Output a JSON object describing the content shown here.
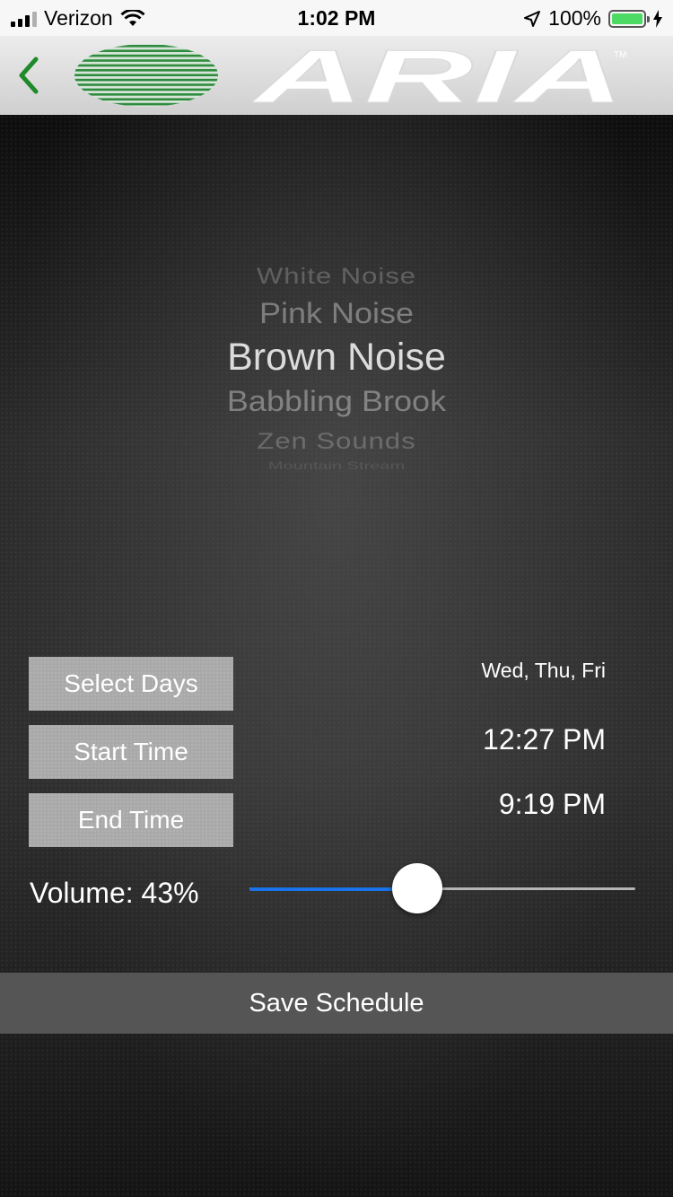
{
  "status_bar": {
    "carrier": "Verizon",
    "time": "1:02 PM",
    "battery_text": "100%",
    "icons": [
      "signal-icon",
      "wifi-icon",
      "location-icon",
      "battery-icon",
      "charging-icon"
    ]
  },
  "header": {
    "back_icon": "chevron-left-icon",
    "logo_text": "ARIA",
    "logo_tm": "TM",
    "colors": {
      "back": "#1e8a2a",
      "logo_stripes": "#2e8b3e"
    }
  },
  "sound_picker": {
    "items": [
      "White Noise",
      "Pink Noise",
      "Brown Noise",
      "Babbling Brook",
      "Zen Sounds",
      "Mountain Stream"
    ],
    "selected": "Brown Noise"
  },
  "schedule": {
    "select_days_label": "Select Days",
    "days_value": "Wed, Thu, Fri",
    "start_time_label": "Start Time",
    "start_time_value": "12:27 PM",
    "end_time_label": "End Time",
    "end_time_value": "9:19 PM"
  },
  "volume": {
    "label": "Volume: 43%",
    "level": 0.43,
    "colors": {
      "fill": "#1a73e8",
      "track": "#b5b5b5"
    }
  },
  "save_label": "Save Schedule"
}
